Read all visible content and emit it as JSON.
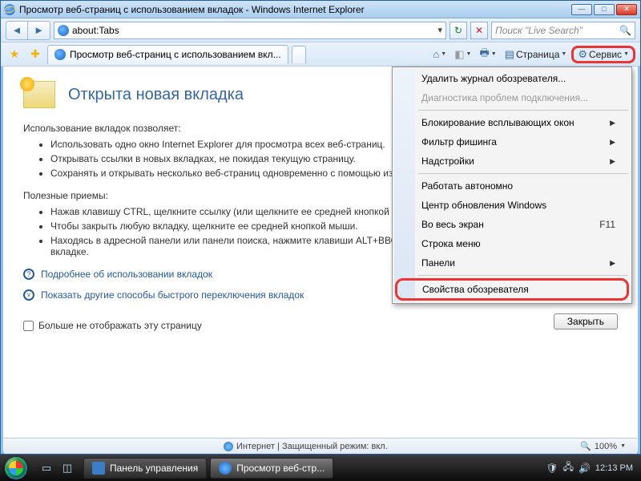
{
  "window": {
    "title": "Просмотр веб-страниц с использованием вкладок - Windows Internet Explorer"
  },
  "address": {
    "url": "about:Tabs"
  },
  "search": {
    "placeholder": "Поиск \"Live Search\""
  },
  "tab": {
    "label": "Просмотр веб-страниц с использованием вкл..."
  },
  "cmdbar": {
    "page": "Страница",
    "service": "Сервис"
  },
  "content": {
    "heading": "Открыта новая вкладка",
    "intro": "Использование вкладок позволяет:",
    "bullets1": [
      "Использовать одно окно Internet Explorer для просмотра всех веб-страниц.",
      "Открывать ссылки в новых вкладках, не покидая текущую страницу.",
      "Сохранять и открывать несколько веб-страниц одновременно с помощью избранного и домашних страниц."
    ],
    "tipsHeading": "Полезные приемы:",
    "bullets2": [
      "Нажав клавишу CTRL, щелкните ссылку (или щелкните ее средней кнопкой мыши).",
      "Чтобы закрыть любую вкладку, щелкните ее средней кнопкой мыши.",
      "Находясь в адресной панели или панели поиска, нажмите клавиши ALT+ВВОД, чтобы открыть результат поиска на новой вкладке."
    ],
    "link1": "Подробнее об использовании вкладок",
    "link2": "Показать другие способы быстрого переключения вкладок",
    "checkbox": "Больше не отображать эту страницу",
    "closeBtn": "Закрыть"
  },
  "menu": {
    "deleteHistory": "Удалить журнал обозревателя...",
    "diag": "Диагностика проблем подключения...",
    "popup": "Блокирование всплывающих окон",
    "phish": "Фильтр фишинга",
    "addons": "Надстройки",
    "offline": "Работать автономно",
    "update": "Центр обновления Windows",
    "fullscreen": "Во весь экран",
    "fullscreenKey": "F11",
    "menubar": "Строка меню",
    "panels": "Панели",
    "options": "Свойства обозревателя"
  },
  "status": {
    "zone": "Интернет | Защищенный режим: вкл.",
    "zoom": "100%"
  },
  "taskbar": {
    "task1": "Панель управления",
    "task2": "Просмотр веб-стр...",
    "clock": "12:13 PM"
  }
}
